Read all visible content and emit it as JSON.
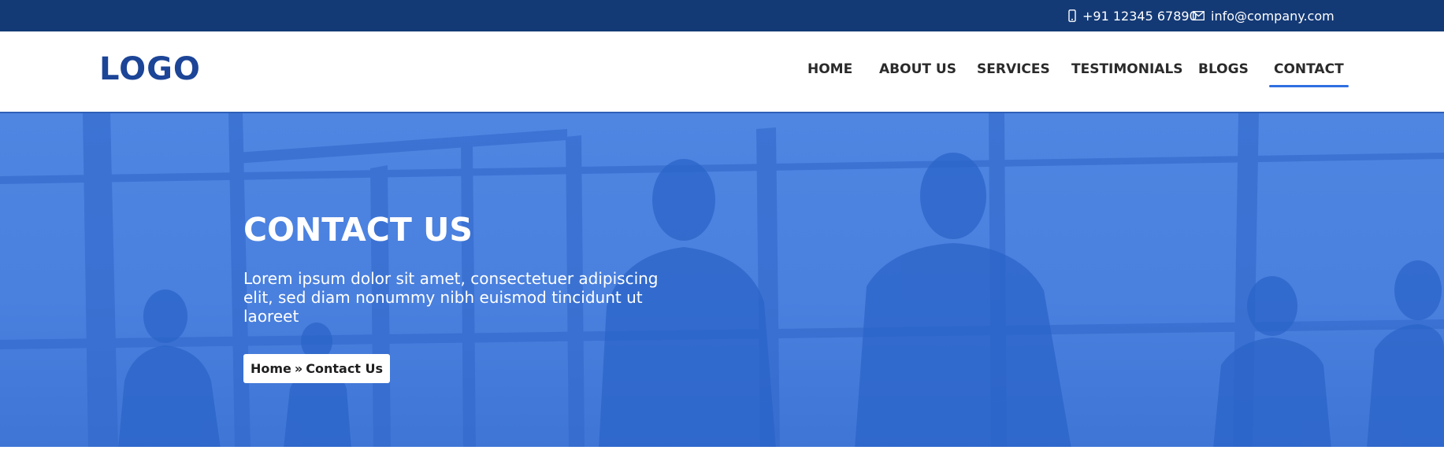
{
  "topbar": {
    "phone": "+91 12345 67890",
    "email": "info@company.com",
    "phone_icon": "mobile-phone-icon",
    "email_icon": "envelope-icon",
    "background": "#143a76"
  },
  "header": {
    "logo": "LOGO",
    "logo_color": "#1c4597",
    "nav": [
      {
        "label": "HOME"
      },
      {
        "label": "ABOUT US"
      },
      {
        "label": "SERVICES"
      },
      {
        "label": "TESTIMONIALS"
      },
      {
        "label": "BLOGS"
      },
      {
        "label": "CONTACT",
        "active": true
      }
    ],
    "active_underline_color": "#2f6fe0"
  },
  "hero": {
    "title": "CONTACT US",
    "description": "Lorem ipsum dolor sit amet, consectetuer adipiscing elit, sed diam nonummy nibh euismod tincidunt ut laoreet",
    "breadcrumb": {
      "home": "Home",
      "separator": "»",
      "current": "Contact Us"
    },
    "background": "#4a80de"
  }
}
